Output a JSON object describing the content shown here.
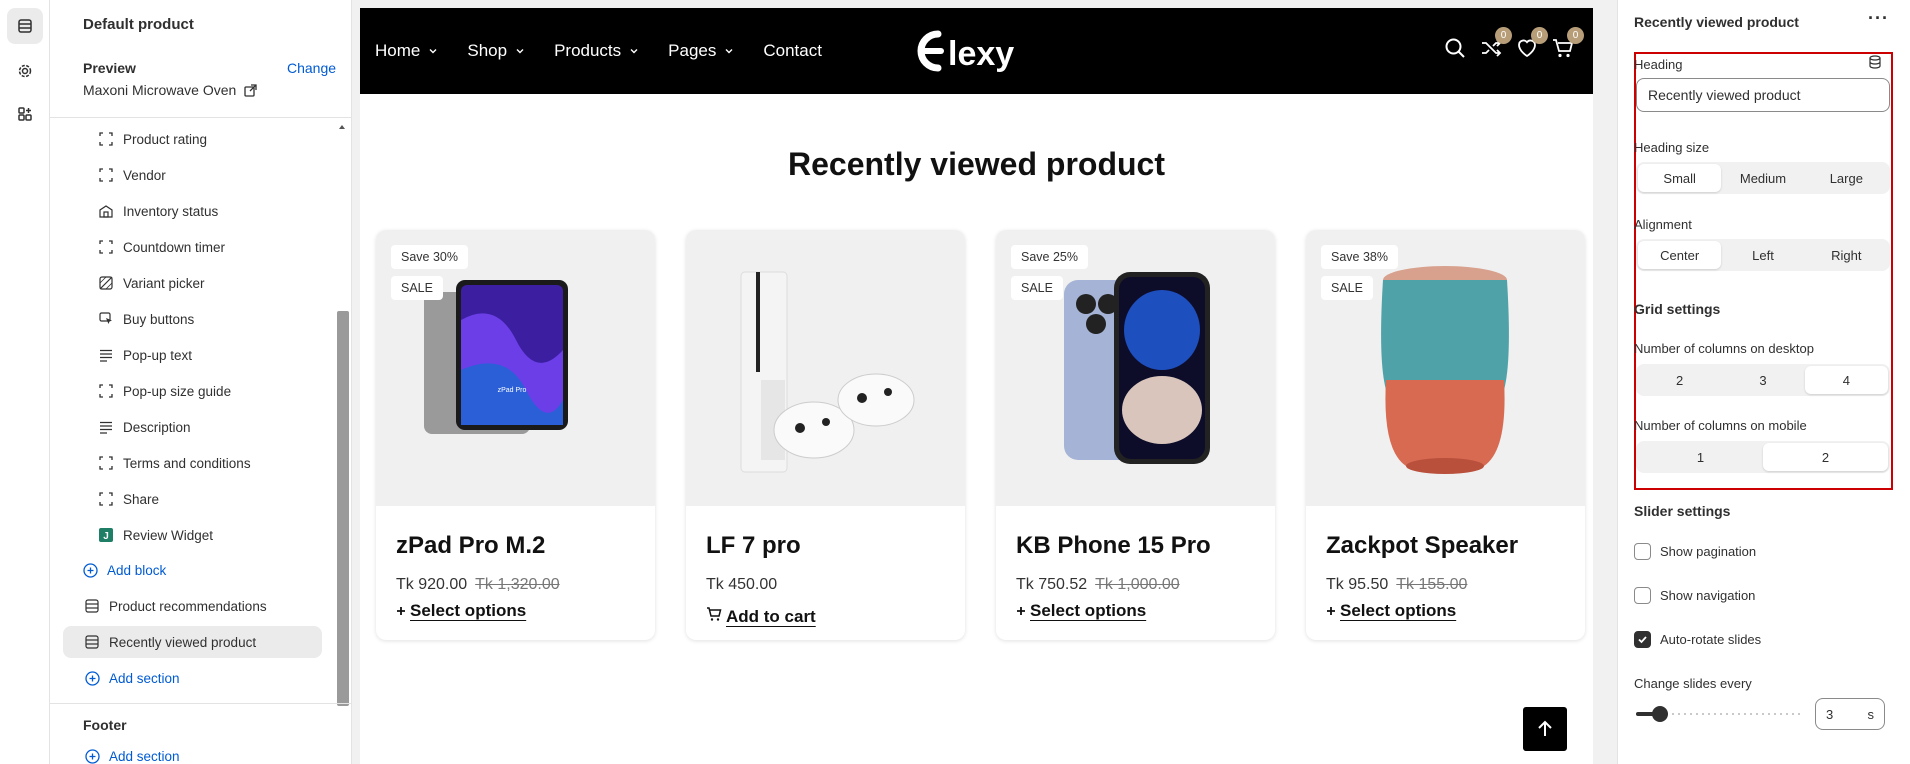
{
  "left_panel": {
    "template_title": "Default product",
    "preview_label": "Preview",
    "change_label": "Change",
    "preview_product": "Maxoni Microwave Oven",
    "blocks": [
      {
        "label": "Product rating",
        "icon": "dashed-square-icon"
      },
      {
        "label": "Vendor",
        "icon": "dashed-square-icon"
      },
      {
        "label": "Inventory status",
        "icon": "building-icon"
      },
      {
        "label": "Countdown timer",
        "icon": "dashed-square-icon"
      },
      {
        "label": "Variant picker",
        "icon": "variant-icon"
      },
      {
        "label": "Buy buttons",
        "icon": "cursor-icon"
      },
      {
        "label": "Pop-up text",
        "icon": "text-lines-icon"
      },
      {
        "label": "Pop-up size guide",
        "icon": "dashed-square-icon"
      },
      {
        "label": "Description",
        "icon": "text-lines-icon"
      },
      {
        "label": "Terms and conditions",
        "icon": "dashed-square-icon"
      },
      {
        "label": "Share",
        "icon": "dashed-square-icon"
      },
      {
        "label": "Review Widget",
        "icon": "app-j-icon"
      }
    ],
    "add_block": "Add block",
    "sections": [
      {
        "label": "Product recommendations"
      },
      {
        "label": "Recently viewed product"
      }
    ],
    "add_section": "Add section",
    "footer_label": "Footer",
    "footer_add_section": "Add section"
  },
  "storefront": {
    "nav": [
      {
        "label": "Home",
        "has_dropdown": true
      },
      {
        "label": "Shop",
        "has_dropdown": true
      },
      {
        "label": "Products",
        "has_dropdown": true
      },
      {
        "label": "Pages",
        "has_dropdown": true
      },
      {
        "label": "Contact",
        "has_dropdown": false
      }
    ],
    "logo_text": "Elexy",
    "badges": {
      "compare": "0",
      "wishlist": "0",
      "cart": "0"
    },
    "section_title": "Recently viewed product",
    "products": [
      {
        "name": "zPad Pro M.2",
        "price": "Tk 920.00",
        "old_price": "Tk 1,320.00",
        "save": "Save 30%",
        "sale": "SALE",
        "cta": "Select options",
        "device_text": "zPad Pro"
      },
      {
        "name": "LF 7 pro",
        "price": "Tk 450.00",
        "old_price": "",
        "save": "",
        "sale": "",
        "cta": "Add to cart",
        "device_text": ""
      },
      {
        "name": "KB Phone 15 Pro",
        "price": "Tk 750.52",
        "old_price": "Tk 1,000.00",
        "save": "Save 25%",
        "sale": "SALE",
        "cta": "Select options",
        "device_text": ""
      },
      {
        "name": "Zackpot Speaker",
        "price": "Tk 95.50",
        "old_price": "Tk 155.00",
        "save": "Save 38%",
        "sale": "SALE",
        "cta": "Select options",
        "device_text": ""
      }
    ]
  },
  "right_panel": {
    "title": "Recently viewed product",
    "heading_label": "Heading",
    "heading_value": "Recently viewed product",
    "heading_size_label": "Heading size",
    "heading_size_options": [
      "Small",
      "Medium",
      "Large"
    ],
    "heading_size_selected": "Small",
    "alignment_label": "Alignment",
    "alignment_options": [
      "Center",
      "Left",
      "Right"
    ],
    "alignment_selected": "Center",
    "grid_settings_label": "Grid settings",
    "desktop_cols_label": "Number of columns on desktop",
    "desktop_cols_options": [
      "2",
      "3",
      "4"
    ],
    "desktop_cols_selected": "4",
    "mobile_cols_label": "Number of columns on mobile",
    "mobile_cols_options": [
      "1",
      "2"
    ],
    "mobile_cols_selected": "2",
    "slider_settings_label": "Slider settings",
    "show_pagination_label": "Show pagination",
    "show_pagination": false,
    "show_navigation_label": "Show navigation",
    "show_navigation": false,
    "auto_rotate_label": "Auto-rotate slides",
    "auto_rotate": true,
    "change_slides_label": "Change slides every",
    "change_slides_value": "3",
    "change_slides_unit": "s",
    "change_slides_range": {
      "min": 3,
      "max": 9,
      "value": 3
    }
  }
}
